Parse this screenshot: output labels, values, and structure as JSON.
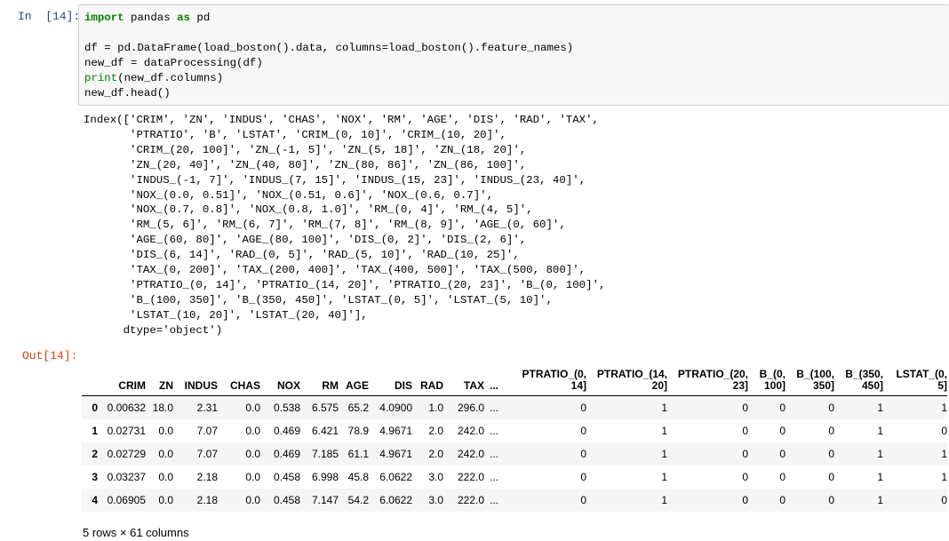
{
  "in_prompt": "In  [14]:",
  "code_lines": [
    "import pandas as pd",
    "",
    "df = pd.DataFrame(load_boston().data, columns=load_boston().feature_names)",
    "new_df = dataProcessing(df)",
    "print(new_df.columns)",
    "new_df.head()"
  ],
  "stream_output": "Index(['CRIM', 'ZN', 'INDUS', 'CHAS', 'NOX', 'RM', 'AGE', 'DIS', 'RAD', 'TAX',\n       'PTRATIO', 'B', 'LSTAT', 'CRIM_(0, 10]', 'CRIM_(10, 20]',\n       'CRIM_(20, 100]', 'ZN_(-1, 5]', 'ZN_(5, 18]', 'ZN_(18, 20]',\n       'ZN_(20, 40]', 'ZN_(40, 80]', 'ZN_(80, 86]', 'ZN_(86, 100]',\n       'INDUS_(-1, 7]', 'INDUS_(7, 15]', 'INDUS_(15, 23]', 'INDUS_(23, 40]',\n       'NOX_(0.0, 0.51]', 'NOX_(0.51, 0.6]', 'NOX_(0.6, 0.7]',\n       'NOX_(0.7, 0.8]', 'NOX_(0.8, 1.0]', 'RM_(0, 4]', 'RM_(4, 5]',\n       'RM_(5, 6]', 'RM_(6, 7]', 'RM_(7, 8]', 'RM_(8, 9]', 'AGE_(0, 60]',\n       'AGE_(60, 80]', 'AGE_(80, 100]', 'DIS_(0, 2]', 'DIS_(2, 6]',\n       'DIS_(6, 14]', 'RAD_(0, 5]', 'RAD_(5, 10]', 'RAD_(10, 25]',\n       'TAX_(0, 200]', 'TAX_(200, 400]', 'TAX_(400, 500]', 'TAX_(500, 800]',\n       'PTRATIO_(0, 14]', 'PTRATIO_(14, 20]', 'PTRATIO_(20, 23]', 'B_(0, 100]',\n       'B_(100, 350]', 'B_(350, 450]', 'LSTAT_(0, 5]', 'LSTAT_(5, 10]',\n       'LSTAT_(10, 20]', 'LSTAT_(20, 40]'],\n      dtype='object')",
  "out_prompt": "Out[14]:",
  "table": {
    "columns": [
      {
        "line1": "CRIM",
        "line2": "",
        "width": 54
      },
      {
        "line1": "ZN",
        "line2": "",
        "width": 31
      },
      {
        "line1": "INDUS",
        "line2": "",
        "width": 50
      },
      {
        "line1": "CHAS",
        "line2": "",
        "width": 48
      },
      {
        "line1": "NOX",
        "line2": "",
        "width": 45
      },
      {
        "line1": "RM",
        "line2": "",
        "width": 43
      },
      {
        "line1": "AGE",
        "line2": "",
        "width": 34
      },
      {
        "line1": "DIS",
        "line2": "",
        "width": 49
      },
      {
        "line1": "RAD",
        "line2": "",
        "width": 35
      },
      {
        "line1": "TAX",
        "line2": "",
        "width": 46
      },
      {
        "line1": "...",
        "line2": "",
        "width": 22,
        "ell": true
      },
      {
        "line1": "PTRATIO_(0,",
        "line2": "14]",
        "width": 93
      },
      {
        "line1": "PTRATIO_(14,",
        "line2": "20]",
        "width": 91
      },
      {
        "line1": "PTRATIO_(20,",
        "line2": "23]",
        "width": 91
      },
      {
        "line1": "B_(0,",
        "line2": "100]",
        "width": 42
      },
      {
        "line1": "B_(100,",
        "line2": "350]",
        "width": 55
      },
      {
        "line1": "B_(350,",
        "line2": "450]",
        "width": 55
      },
      {
        "line1": "LSTAT_(0,",
        "line2": "5]",
        "width": 72
      }
    ],
    "rows": [
      {
        "index": "0",
        "cells": [
          "0.00632",
          "18.0",
          "2.31",
          "0.0",
          "0.538",
          "6.575",
          "65.2",
          "4.0900",
          "1.0",
          "296.0",
          "...",
          "0",
          "1",
          "0",
          "0",
          "0",
          "1",
          "1"
        ]
      },
      {
        "index": "1",
        "cells": [
          "0.02731",
          "0.0",
          "7.07",
          "0.0",
          "0.469",
          "6.421",
          "78.9",
          "4.9671",
          "2.0",
          "242.0",
          "...",
          "0",
          "1",
          "0",
          "0",
          "0",
          "1",
          "0"
        ]
      },
      {
        "index": "2",
        "cells": [
          "0.02729",
          "0.0",
          "7.07",
          "0.0",
          "0.469",
          "7.185",
          "61.1",
          "4.9671",
          "2.0",
          "242.0",
          "...",
          "0",
          "1",
          "0",
          "0",
          "0",
          "1",
          "1"
        ]
      },
      {
        "index": "3",
        "cells": [
          "0.03237",
          "0.0",
          "2.18",
          "0.0",
          "0.458",
          "6.998",
          "45.8",
          "6.0622",
          "3.0",
          "222.0",
          "...",
          "0",
          "1",
          "0",
          "0",
          "0",
          "1",
          "1"
        ]
      },
      {
        "index": "4",
        "cells": [
          "0.06905",
          "0.0",
          "2.18",
          "0.0",
          "0.458",
          "7.147",
          "54.2",
          "6.0622",
          "3.0",
          "222.0",
          "...",
          "0",
          "1",
          "0",
          "0",
          "0",
          "1",
          "0"
        ]
      }
    ]
  },
  "shape_text": "5 rows × 61 columns"
}
